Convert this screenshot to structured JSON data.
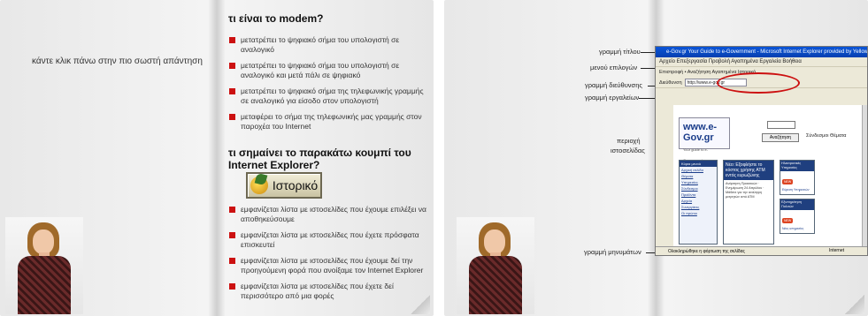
{
  "book1": {
    "instruction": "κάντε κλικ πάνω στην πιο σωστή απάντηση",
    "question1": "τι είναι το modem?",
    "options1": [
      "μετατρέπει το ψηφιακό σήμα του υπολογιστή σε αναλογικό",
      "μετατρέπει το ψηφιακό σήμα του υπολογιστή σε αναλογικό και μετά πάλι σε ψηφιακό",
      "μετατρέπει το ψηφιακό σήμα της τηλεφωνικής γραμμής σε αναλογικό για είσοδο στον υπολογιστή",
      "μεταφέρει το σήμα της τηλεφωνικής μας γραμμής στον παροχέα του Internet"
    ],
    "question2": "τι σημαίνει το παρακάτω κουμπί του Internet Explorer?",
    "button_label": "Ιστορικό",
    "options2": [
      "εμφανίζεται λίστα με ιστοσελίδες που έχουμε επιλέξει να αποθηκεύσουμε",
      "εμφανίζεται λίστα με ιστοσελίδες που έχετε πρόσφατα επισκευτεί",
      "εμφανίζεται λίστα με ιστοσελίδες που έχουμε δεί την προηγούμενη φορά που ανοίξαμε τον Internet Explorer",
      "εμφανίζεται λίστα με ιστοσελίδες που έχετε δεί περισσότερο από μια φορές"
    ]
  },
  "book2": {
    "labels": {
      "title_bar": "γραμμή τίτλου",
      "menu_bar": "μενού επιλογών",
      "address_bar": "γραμμή διεύθυνσης",
      "tool_bar": "γραμμή εργαλείων",
      "page_area_1": "περιοχή",
      "page_area_2": "ιστοσελίδας",
      "status_bar": "γραμμή μηνυμάτων"
    },
    "screenshot": {
      "title": "e-Gov.gr  Your Guide to e-Government - Microsoft Internet Explorer provided by Yellow On Line",
      "menu": "Αρχείο  Επεξεργασία  Προβολή  Αγαπημένα  Εργαλεία  Βοήθεια",
      "toolbar": "Επιστροφή  •  Αναζήτηση  Αγαπημένα  Ιστορικό",
      "address_label": "Διεύθυνση",
      "address_value": "http://www.e-gov.gr",
      "logo": "www.e-Gov.gr",
      "logo_sub": "Your guide to e-Government",
      "search_button": "Αναζήτηση",
      "sites_label": "Σύνδεσμοι  Θέματα",
      "menu_header": "Κύρια μενού",
      "menu_links": [
        "Αρχική σελίδα",
        "Θέματα",
        "Υπηρεσίες",
        "Σύνδεσμοι",
        "Προϊόντα",
        "Αρχεία",
        "Συνεργάτες",
        "Οι πρώτοι"
      ],
      "news_header": "Νέο: Εξοφλήστε το κόστος χρήσης ΑΤΜ εντός ευρωζώνης",
      "news_body": "Ανάρτηση Πρακτικών · Ενημέρωση 24 Απριλίου · Μάθετε για την ανάληψη μετρητών από ΑΤΜ",
      "right_header": "Ηλεκτρονικές Υπηρεσίες",
      "right_link": "Εύρεση Υπηρεσιών",
      "right2_header": "Εξυπηρέτηση Πολιτών",
      "right2_link": "Νέες υπηρεσίες",
      "new_badge": "NEW",
      "status_text": "Ολοκληρώθηκε η φόρτωση της σελίδας",
      "status_right": "Internet"
    }
  }
}
